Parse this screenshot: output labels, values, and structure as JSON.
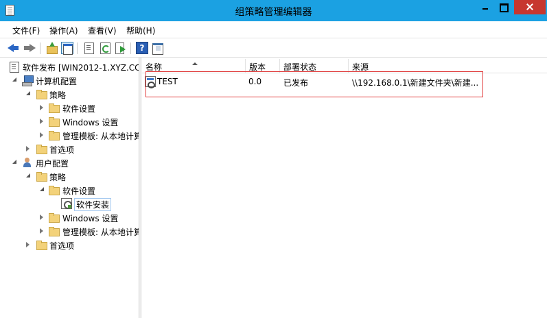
{
  "window": {
    "title": "组策略管理编辑器"
  },
  "menu": {
    "items": [
      "文件(F)",
      "操作(A)",
      "查看(V)",
      "帮助(H)"
    ]
  },
  "toolbar": {
    "icons": [
      "back-arrow-icon",
      "forward-arrow-icon",
      "up-folder-icon",
      "show-hide-tree-icon",
      "properties-icon",
      "refresh-icon",
      "export-list-icon",
      "help-icon",
      "show-hide-action-pane-icon"
    ],
    "help_label": "?"
  },
  "tree": {
    "root": "软件发布 [WIN2012-1.XYZ.CC",
    "computer_config": "计算机配置",
    "policies": "策略",
    "software_settings": "软件设置",
    "windows_settings": "Windows 设置",
    "admin_templates": "管理模板: 从本地计算",
    "preferences": "首选项",
    "user_config": "用户配置",
    "software_install": "软件安装"
  },
  "columns": {
    "name": "名称",
    "version": "版本",
    "deploy_state": "部署状态",
    "source": "来源"
  },
  "rows": [
    {
      "name": "TEST",
      "version": "0.0",
      "deploy_state": "已发布",
      "source": "\\\\192.168.0.1\\新建文件夹\\新建..."
    }
  ],
  "colors": {
    "titlebar": "#1ba1e2",
    "close_button": "#c7372f",
    "highlight_border": "#e03b3b"
  }
}
